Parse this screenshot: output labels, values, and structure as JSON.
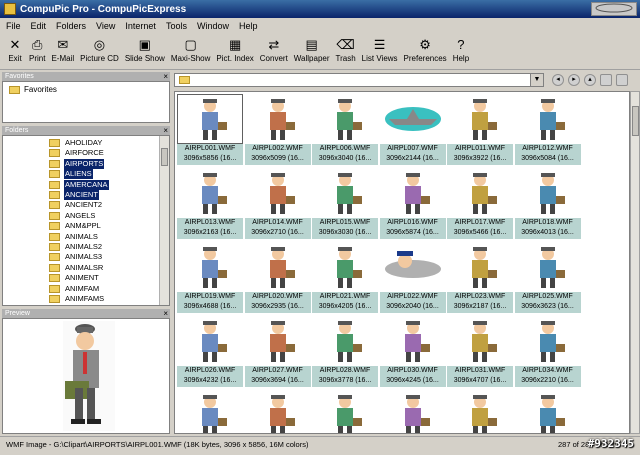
{
  "window": {
    "title": "CompuPic Pro - CompuPicExpress",
    "brand": ""
  },
  "menu": [
    "File",
    "Edit",
    "Folders",
    "View",
    "Internet",
    "Tools",
    "Window",
    "Help"
  ],
  "toolbar": [
    {
      "label": "Exit",
      "icon": "exit-icon"
    },
    {
      "label": "Print",
      "icon": "printer-icon"
    },
    {
      "label": "E-Mail",
      "icon": "email-icon"
    },
    {
      "label": "Picture CD",
      "icon": "cd-icon"
    },
    {
      "label": "Slide Show",
      "icon": "slideshow-icon"
    },
    {
      "label": "Maxi-Show",
      "icon": "maxishow-icon"
    },
    {
      "label": "Pict. Index",
      "icon": "index-icon"
    },
    {
      "label": "Convert",
      "icon": "convert-icon"
    },
    {
      "label": "Wallpaper",
      "icon": "wallpaper-icon"
    },
    {
      "label": "Trash",
      "icon": "trash-icon"
    },
    {
      "label": "List Views",
      "icon": "listviews-icon"
    },
    {
      "label": "Preferences",
      "icon": "preferences-icon"
    },
    {
      "label": "Help",
      "icon": "help-icon"
    }
  ],
  "panels": {
    "favorites_title": "Favorites",
    "favorites_item": "Favorites",
    "folders_title": "Folders",
    "preview_title": "Preview",
    "close": "×"
  },
  "folders": [
    {
      "name": "AHOLIDAY",
      "selected": false
    },
    {
      "name": "AIRFORCE",
      "selected": false
    },
    {
      "name": "AIRPORTS",
      "selected": true
    },
    {
      "name": "ALIENS",
      "selected": true
    },
    {
      "name": "AMERCANA",
      "selected": true
    },
    {
      "name": "ANCIENT",
      "selected": true
    },
    {
      "name": "ANCIENT2",
      "selected": false
    },
    {
      "name": "ANGELS",
      "selected": false
    },
    {
      "name": "ANM&PPL",
      "selected": false
    },
    {
      "name": "ANIMALS",
      "selected": false
    },
    {
      "name": "ANIMALS2",
      "selected": false
    },
    {
      "name": "ANIMALS3",
      "selected": false
    },
    {
      "name": "ANIMALSR",
      "selected": false
    },
    {
      "name": "ANIMENT",
      "selected": false
    },
    {
      "name": "ANIMFAM",
      "selected": false
    },
    {
      "name": "ANIMFAMS",
      "selected": false
    }
  ],
  "thumbnails": [
    {
      "name": "AIRPL001.WMF",
      "info": "3096x5856 (16..."
    },
    {
      "name": "AIRPL002.WMF",
      "info": "3096x5099 (16..."
    },
    {
      "name": "AIRPL006.WMF",
      "info": "3096x3040 (16..."
    },
    {
      "name": "AIRPL007.WMF",
      "info": "3096x2144 (16..."
    },
    {
      "name": "AIRPL011.WMF",
      "info": "3096x3922 (16..."
    },
    {
      "name": "AIRPL012.WMF",
      "info": "3096x5084 (16..."
    },
    {
      "name": "AIRPL013.WMF",
      "info": "3096x2163 (16..."
    },
    {
      "name": "AIRPL014.WMF",
      "info": "3096x2710 (16..."
    },
    {
      "name": "AIRPL015.WMF",
      "info": "3096x3030 (16..."
    },
    {
      "name": "AIRPL016.WMF",
      "info": "3096x5874 (16..."
    },
    {
      "name": "AIRPL017.WMF",
      "info": "3096x5466 (16..."
    },
    {
      "name": "AIRPL018.WMF",
      "info": "3096x4013 (16..."
    },
    {
      "name": "AIRPL019.WMF",
      "info": "3096x4688 (16..."
    },
    {
      "name": "AIRPL020.WMF",
      "info": "3096x2935 (16..."
    },
    {
      "name": "AIRPL021.WMF",
      "info": "3096x4205 (16..."
    },
    {
      "name": "AIRPL022.WMF",
      "info": "3096x2040 (16..."
    },
    {
      "name": "AIRPL023.WMF",
      "info": "3096x2187 (16..."
    },
    {
      "name": "AIRPL025.WMF",
      "info": "3096x3623 (16..."
    },
    {
      "name": "AIRPL026.WMF",
      "info": "3096x4232 (16..."
    },
    {
      "name": "AIRPL027.WMF",
      "info": "3096x3694 (16..."
    },
    {
      "name": "AIRPL028.WMF",
      "info": "3096x3778 (16..."
    },
    {
      "name": "AIRPL030.WMF",
      "info": "3096x4245 (16..."
    },
    {
      "name": "AIRPL031.WMF",
      "info": "3096x4707 (16..."
    },
    {
      "name": "AIRPL034.WMF",
      "info": "3096x2210 (16..."
    },
    {
      "name": "",
      "info": ""
    },
    {
      "name": "",
      "info": ""
    },
    {
      "name": "",
      "info": ""
    },
    {
      "name": "",
      "info": ""
    },
    {
      "name": "",
      "info": ""
    },
    {
      "name": "",
      "info": ""
    }
  ],
  "status": {
    "text": "WMF Image - G:\\Clipart\\AIRPORTS\\AIRPL001.WMF  (18K bytes, 3096 x 5856, 16M colors)",
    "count": "287 of 287 Shown"
  },
  "watermark": "#932345",
  "colors": {
    "title_bar": "#0a246a",
    "selection": "#0a246a",
    "caption_bg": "#b8d4d0"
  }
}
